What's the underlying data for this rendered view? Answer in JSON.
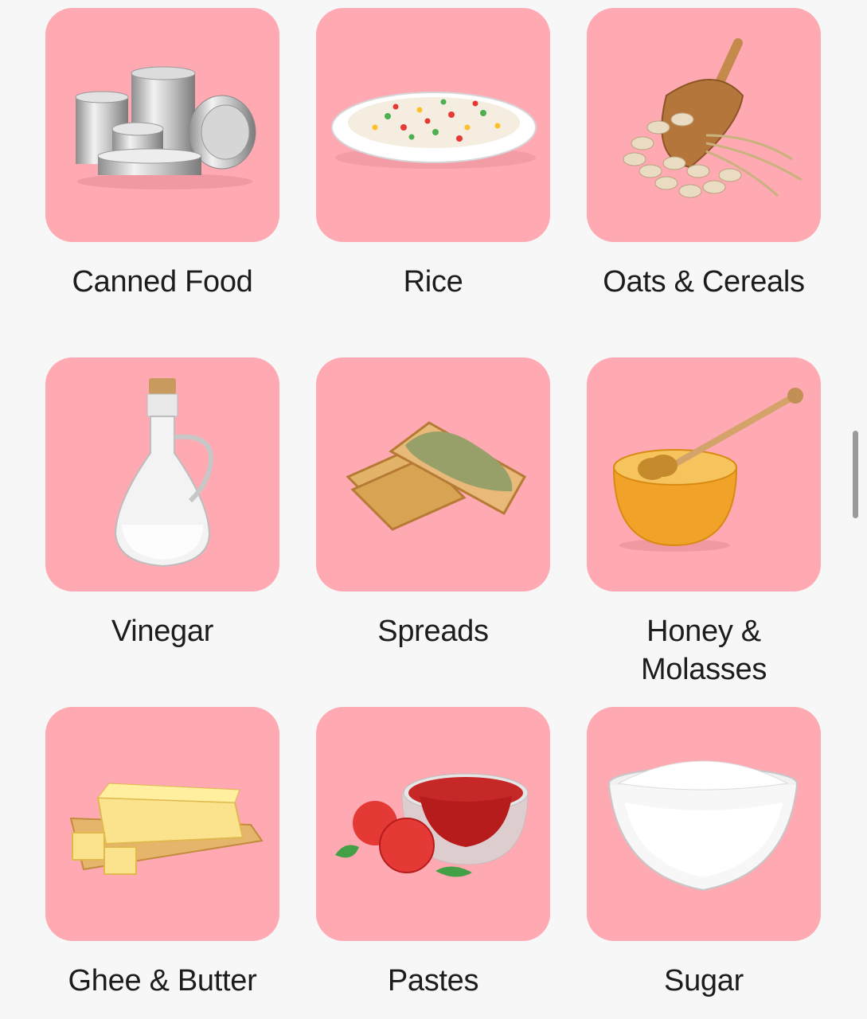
{
  "categories": [
    {
      "label": "Canned Food",
      "icon": "canned-food-image"
    },
    {
      "label": "Rice",
      "icon": "rice-image"
    },
    {
      "label": "Oats & Cereals",
      "icon": "oats-cereals-image"
    },
    {
      "label": "Vinegar",
      "icon": "vinegar-image"
    },
    {
      "label": "Spreads",
      "icon": "spreads-image"
    },
    {
      "label": "Honey &\nMolasses",
      "icon": "honey-molasses-image"
    },
    {
      "label": "Ghee & Butter",
      "icon": "ghee-butter-image"
    },
    {
      "label": "Pastes",
      "icon": "pastes-image"
    },
    {
      "label": "Sugar",
      "icon": "sugar-image"
    }
  ],
  "colors": {
    "tile_background": "#ffa9b2",
    "page_background": "#f7f7f7",
    "label_text": "#1c1c1c"
  }
}
